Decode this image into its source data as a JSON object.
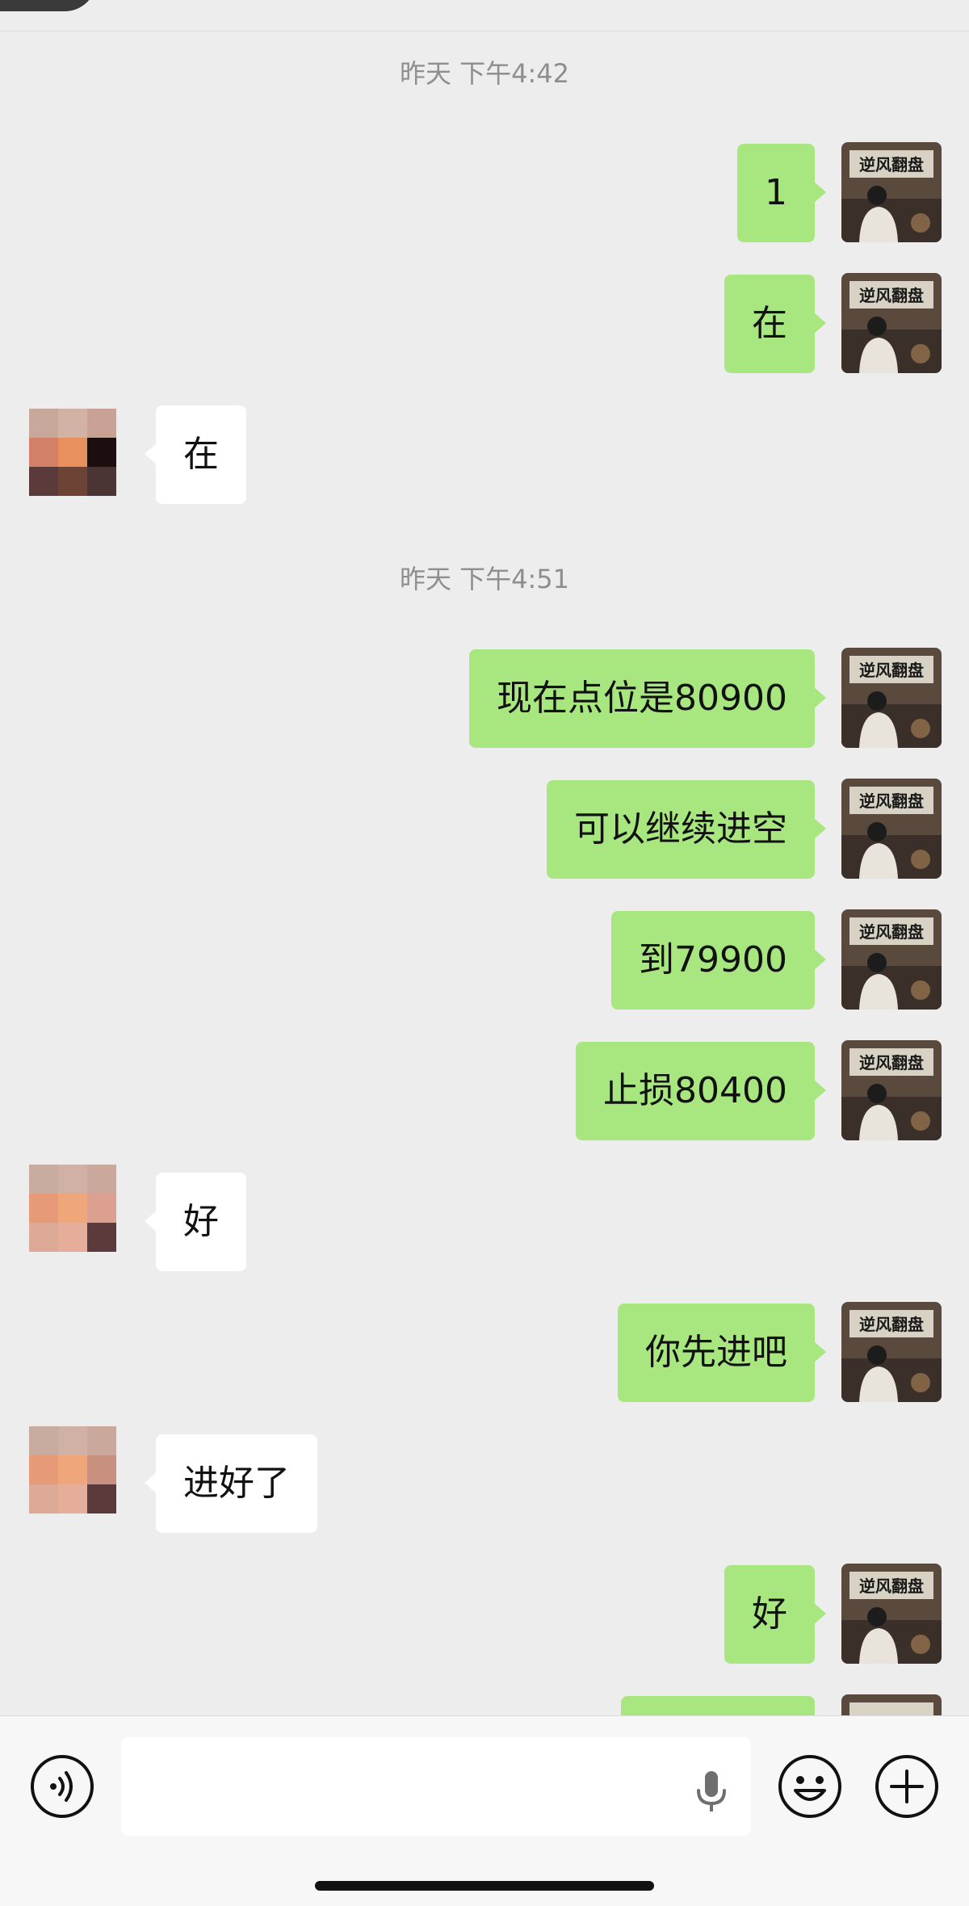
{
  "timestamps": [
    "昨天 下午4:42",
    "昨天 下午4:51"
  ],
  "messages": [
    {
      "from": "self",
      "text": "1"
    },
    {
      "from": "self",
      "text": "在"
    },
    {
      "from": "other",
      "text": "在"
    },
    {
      "from": "self",
      "text": "现在点位是80900"
    },
    {
      "from": "self",
      "text": "可以继续进空"
    },
    {
      "from": "self",
      "text": "到79900"
    },
    {
      "from": "self",
      "text": "止损80400"
    },
    {
      "from": "other",
      "text": "好"
    },
    {
      "from": "self",
      "text": "你先进吧"
    },
    {
      "from": "other",
      "text": "进好了"
    },
    {
      "from": "self",
      "text": "好"
    },
    {
      "from": "self",
      "text": ""
    }
  ],
  "avatars": {
    "self_banner_text": "逆风翻盘"
  },
  "input_bar": {
    "placeholder": "",
    "icons": [
      "voice-icon",
      "microphone-icon",
      "emoji-icon",
      "plus-icon"
    ]
  },
  "colors": {
    "background": "#EDEDED",
    "self_bubble": "#A8E77F",
    "other_bubble": "#FFFFFF",
    "timestamp": "#8E8E8E"
  }
}
